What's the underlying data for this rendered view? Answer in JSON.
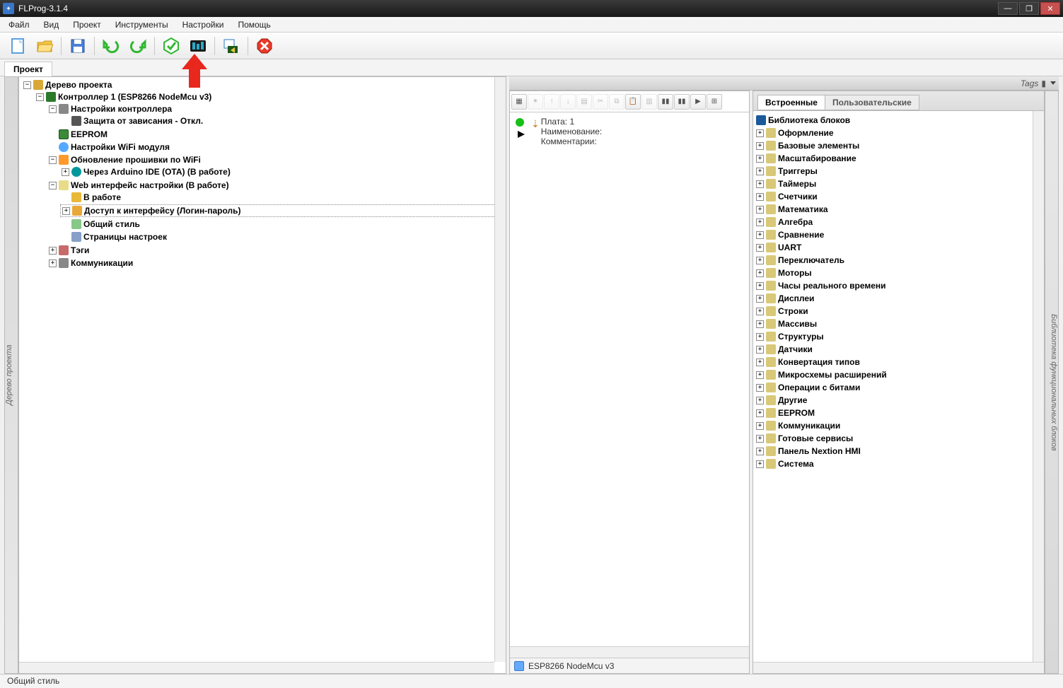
{
  "window": {
    "title": "FLProg-3.1.4"
  },
  "menu": {
    "file": "Файл",
    "view": "Вид",
    "project": "Проект",
    "tools": "Инструменты",
    "settings": "Настройки",
    "help": "Помощь"
  },
  "pagetab": "Проект",
  "leftSideLabel": "Дерево проекта",
  "rightSideLabel": "Библиотека функциональных блоков",
  "projectTree": {
    "root": "Дерево проекта",
    "controller": "Контроллер 1 (ESP8266 NodeMcu v3)",
    "ctrlSettings": "Настройки контроллера",
    "hangProtect": "Защита от зависания - Откл.",
    "eeprom": "EEPROM",
    "wifi": "Настройки WiFi модуля",
    "wifiUpdate": "Обновление прошивки по WiFi",
    "ota": "Через Arduino IDE (OTA) (В работе)",
    "webSettings": "Web интерфейс настройки (В работе)",
    "inWork": "В работе",
    "access": "Доступ к интерфейсу (Логин-пароль)",
    "commonStyle": "Общий стиль",
    "settingsPages": "Страницы настроек",
    "tags": "Тэги",
    "comm": "Коммуникации"
  },
  "tagsStrip": "Tags",
  "centerInfo": {
    "board": "Плата: 1",
    "name": "Наименование:",
    "comments": "Комментарии:"
  },
  "boardBar": "ESP8266 NodeMcu v3",
  "libTabs": {
    "builtin": "Встроенные",
    "user": "Пользовательские"
  },
  "lib": {
    "root": "Библиотека блоков",
    "items": [
      "Оформление",
      "Базовые элементы",
      "Масштабирование",
      "Триггеры",
      "Таймеры",
      "Счетчики",
      "Математика",
      "Алгебра",
      "Сравнение",
      "UART",
      "Переключатель",
      "Моторы",
      "Часы реального времени",
      "Дисплеи",
      "Строки",
      "Массивы",
      "Структуры",
      "Датчики",
      "Конвертация типов",
      "Микросхемы расширений",
      "Операции с битами",
      "Другие",
      "EEPROM",
      "Коммуникации",
      "Готовые сервисы",
      "Панель Nextion HMI",
      "Система"
    ]
  },
  "status": "Общий стиль"
}
